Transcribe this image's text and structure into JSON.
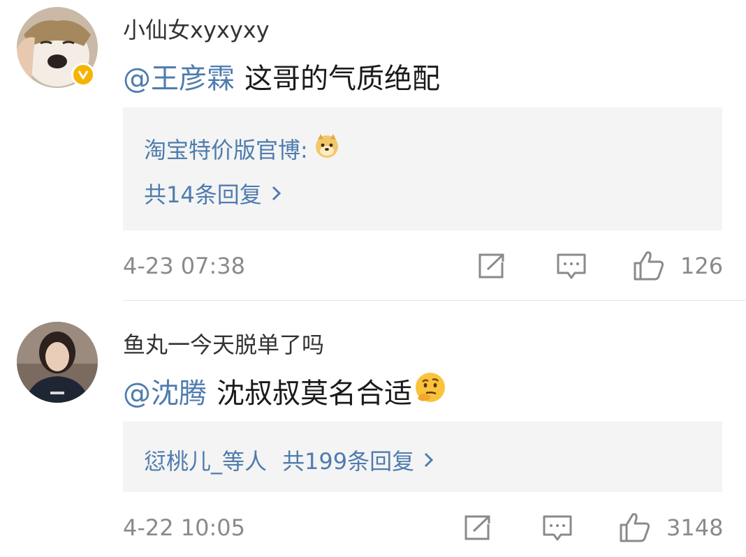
{
  "comments": [
    {
      "username": "小仙女xyxyxy",
      "mention": "@王彦霖",
      "text": "这哥的气质绝配",
      "verified": true,
      "reply_author": "淘宝特价版官博:",
      "reply_emoji": "doge-emoji",
      "reply_count_text": "共14条回复",
      "time": "4-23 07:38",
      "likes": "126"
    },
    {
      "username": "鱼丸一今天脱单了吗",
      "mention": "@沈腾",
      "text": "沈叔叔莫名合适",
      "trailing_emoji": "thinking-face-emoji",
      "reply_author": "愆桃儿_等人",
      "reply_count_text": "共199条回复",
      "time": "4-22 10:05",
      "likes": "3148"
    }
  ],
  "colors": {
    "link": "#4f7cae",
    "meta": "#8a8a8a",
    "reply_bg": "#f4f4f4",
    "badge": "#f6b400"
  }
}
